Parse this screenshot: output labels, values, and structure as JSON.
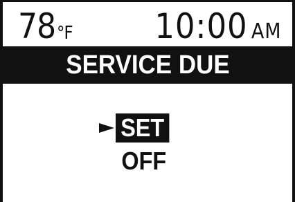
{
  "status": {
    "temperature_value": "78",
    "temperature_unit": "°F",
    "time": "10:00",
    "time_period": "AM"
  },
  "screen": {
    "title": "SERVICE DUE"
  },
  "menu": {
    "cursor_icon": "triangle-right-icon",
    "selected_index": 0,
    "items": [
      {
        "label": "SET"
      },
      {
        "label": "OFF"
      }
    ]
  },
  "colors": {
    "foreground": "#111111",
    "background": "#ffffff",
    "highlight_text": "#ffffff"
  }
}
